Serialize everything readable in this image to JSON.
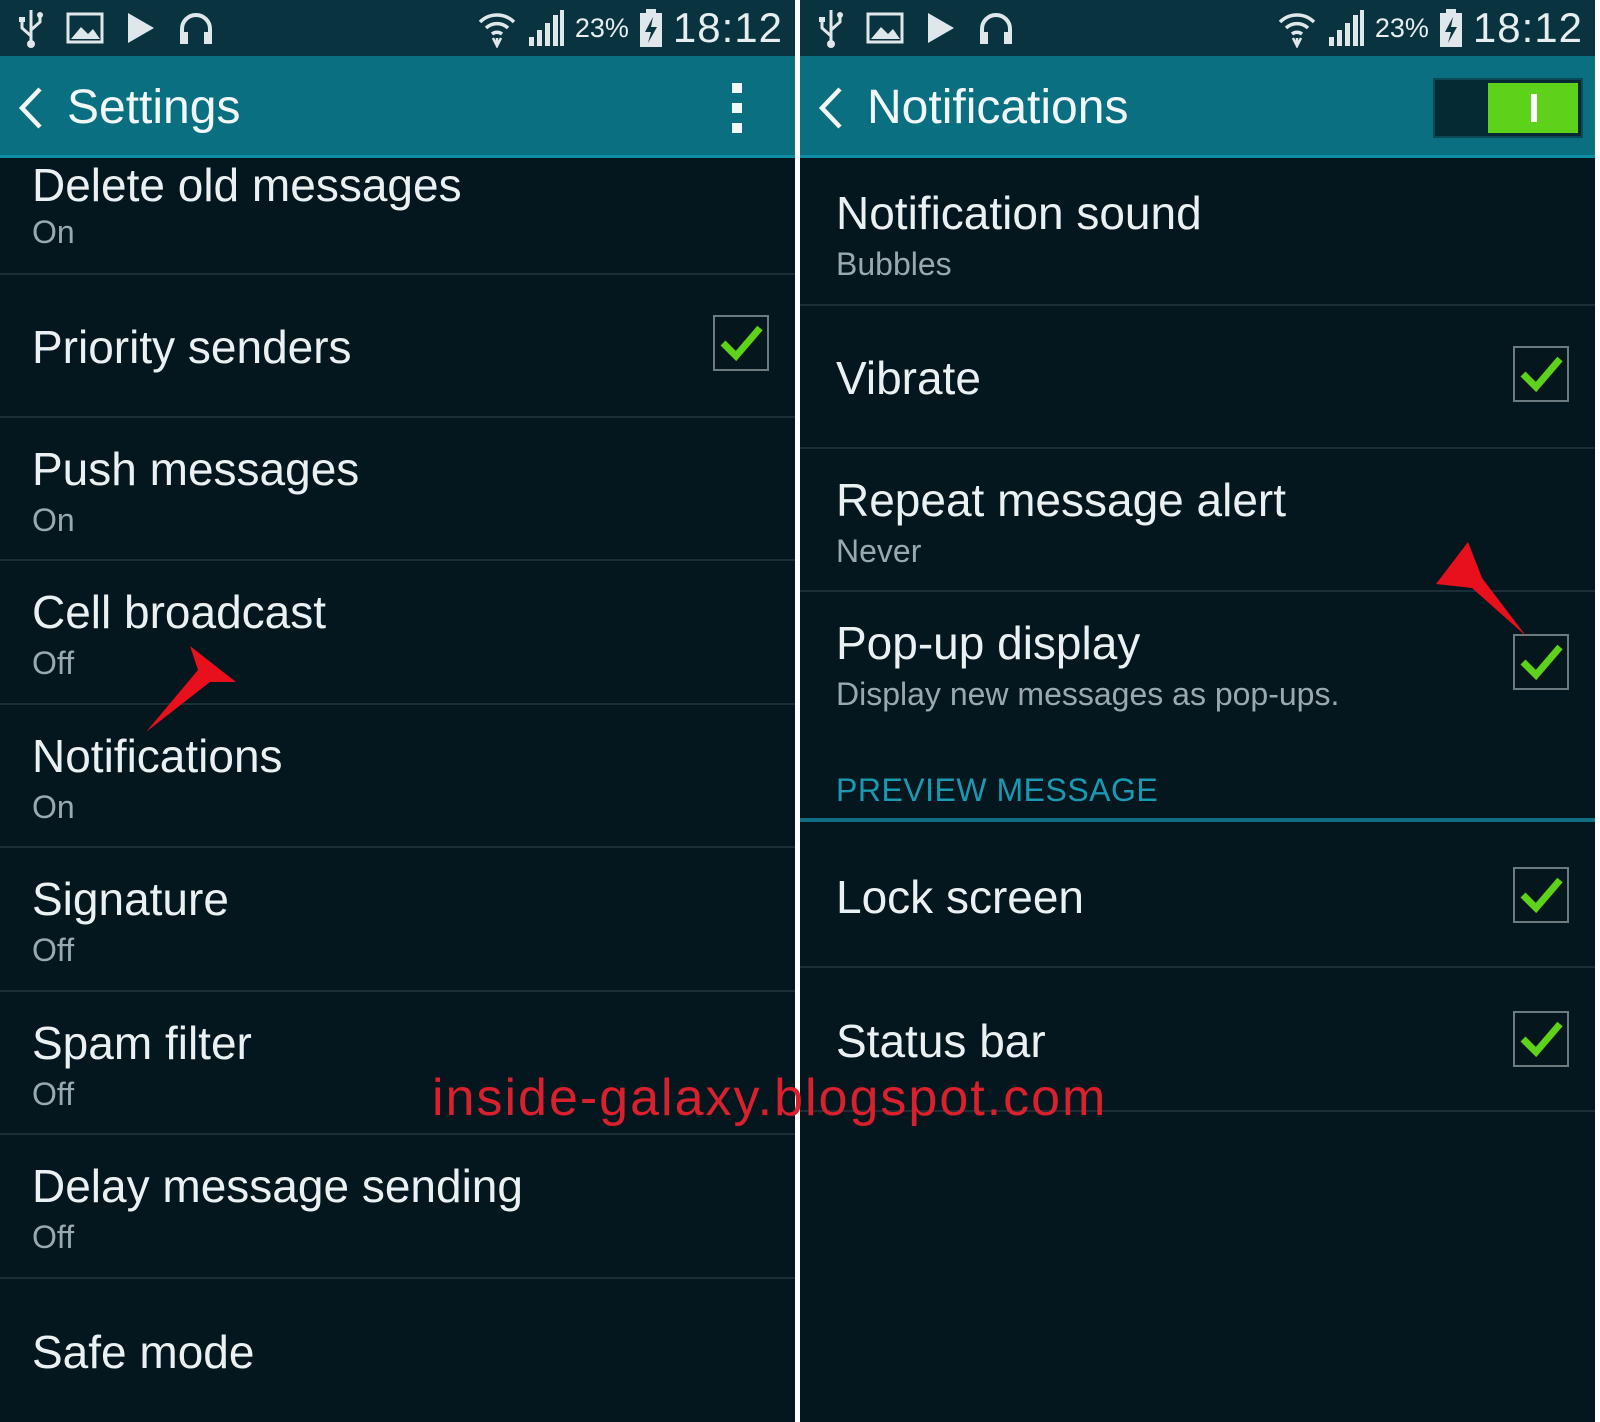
{
  "status_bar": {
    "battery_percent": "23%",
    "time": "18:12"
  },
  "left_screen": {
    "title": "Settings",
    "items": [
      {
        "title": "Delete old messages",
        "subtitle": "On"
      },
      {
        "title": "Priority senders",
        "checked": true
      },
      {
        "title": "Push messages",
        "subtitle": "On"
      },
      {
        "title": "Cell broadcast",
        "subtitle": "Off"
      },
      {
        "title": "Notifications",
        "subtitle": "On"
      },
      {
        "title": "Signature",
        "subtitle": "Off"
      },
      {
        "title": "Spam filter",
        "subtitle": "Off"
      },
      {
        "title": "Delay message sending",
        "subtitle": "Off"
      },
      {
        "title": "Safe mode"
      }
    ]
  },
  "right_screen": {
    "title": "Notifications",
    "master_switch_on": true,
    "items": [
      {
        "title": "Notification sound",
        "subtitle": "Bubbles"
      },
      {
        "title": "Vibrate",
        "checked": true
      },
      {
        "title": "Repeat message alert",
        "subtitle": "Never"
      },
      {
        "title": "Pop-up display",
        "subtitle": "Display new messages as pop-ups.",
        "checked": true
      }
    ],
    "section_header": "PREVIEW MESSAGE",
    "preview_items": [
      {
        "title": "Lock screen",
        "checked": true
      },
      {
        "title": "Status bar",
        "checked": true
      }
    ]
  },
  "watermark": "inside-galaxy.blogspot.com",
  "colors": {
    "background": "#04171f",
    "action_bar": "#0a6f80",
    "accent_green": "#5ed11b",
    "section_header": "#1b98b2",
    "arrow_red": "#e8101c"
  }
}
